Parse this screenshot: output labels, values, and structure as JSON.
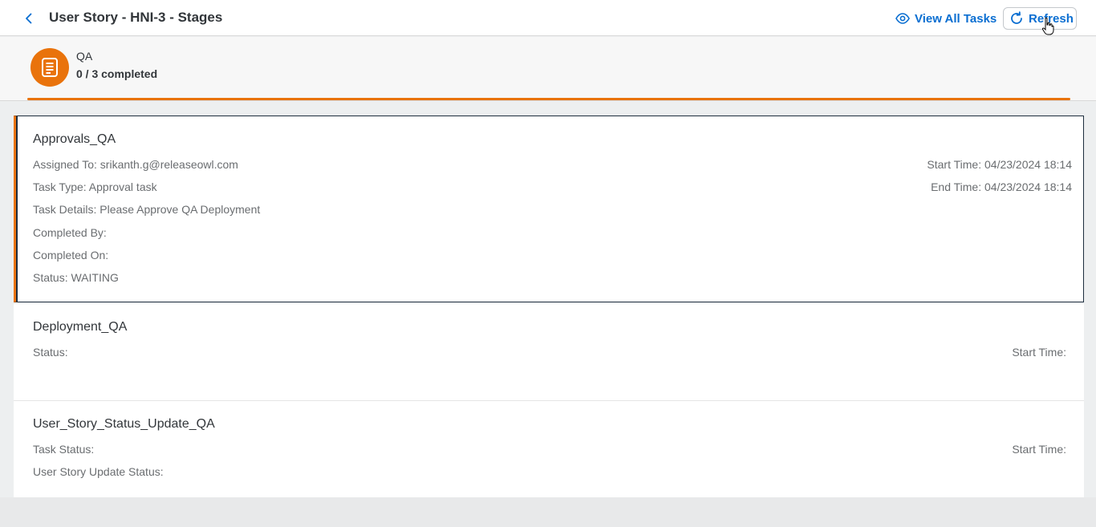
{
  "header": {
    "title": "User Story - HNI-3 - Stages",
    "view_all_label": "View All Tasks",
    "refresh_label": "Refresh"
  },
  "stage": {
    "name": "QA",
    "progress": "0 / 3 completed",
    "icon": "document-icon",
    "color": "#e9730c"
  },
  "tasks": [
    {
      "title": "Approvals_QA",
      "assigned_to": "Assigned To: srikanth.g@releaseowl.com",
      "task_type": "Task Type: Approval task",
      "task_details": "Task Details: Please Approve QA Deployment",
      "completed_by": "Completed By:",
      "completed_on": "Completed On:",
      "status": "Status: WAITING",
      "start_time": "Start Time: 04/23/2024 18:14",
      "end_time": "End Time: 04/23/2024 18:14"
    },
    {
      "title": "Deployment_QA",
      "status": "Status:",
      "start_time": "Start Time:"
    },
    {
      "title": "User_Story_Status_Update_QA",
      "task_status": "Task Status:",
      "update_status": "User Story Update Status:",
      "start_time": "Start Time:"
    }
  ],
  "colors": {
    "accent": "#0a6ed1",
    "stage": "#e9730c",
    "selected_border": "#1d2d3e"
  }
}
